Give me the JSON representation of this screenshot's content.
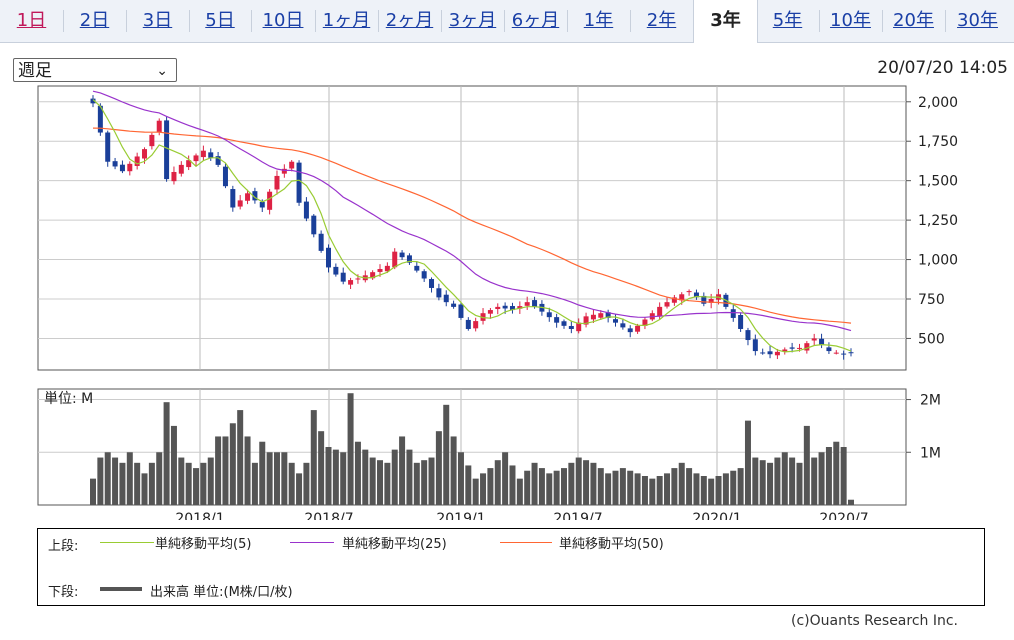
{
  "tabs": [
    {
      "label": "1日",
      "selected": false
    },
    {
      "label": "2日",
      "selected": false
    },
    {
      "label": "3日",
      "selected": false
    },
    {
      "label": "5日",
      "selected": false
    },
    {
      "label": "10日",
      "selected": false
    },
    {
      "label": "1ヶ月",
      "selected": false
    },
    {
      "label": "2ヶ月",
      "selected": false
    },
    {
      "label": "3ヶ月",
      "selected": false
    },
    {
      "label": "6ヶ月",
      "selected": false
    },
    {
      "label": "1年",
      "selected": false
    },
    {
      "label": "2年",
      "selected": false
    },
    {
      "label": "3年",
      "selected": true
    },
    {
      "label": "5年",
      "selected": false
    },
    {
      "label": "10年",
      "selected": false
    },
    {
      "label": "20年",
      "selected": false
    },
    {
      "label": "30年",
      "selected": false
    }
  ],
  "period_select": {
    "value": "週足",
    "icon": "chevron-down-icon"
  },
  "timestamp": "20/07/20 14:05",
  "legend": {
    "upper_label": "上段:",
    "lower_label": "下段:",
    "items": [
      {
        "label": "単純移動平均(5)",
        "color": "#99cc33"
      },
      {
        "label": "単純移動平均(25)",
        "color": "#9933cc"
      },
      {
        "label": "単純移動平均(50)",
        "color": "#ff6633"
      }
    ],
    "volume": {
      "label": "出来高 単位:(M株/口/枚)",
      "color": "#555555"
    }
  },
  "credit": "(c)Ouants Research Inc.",
  "chart_data": {
    "type": "candlestick",
    "price_axis": {
      "ticks": [
        "2,000",
        "1,750",
        "1,500",
        "1,250",
        "1,000",
        "750",
        "500"
      ],
      "values": [
        2000,
        1750,
        1500,
        1250,
        1000,
        750,
        500
      ],
      "ylim": [
        300,
        2100
      ]
    },
    "volume_axis": {
      "unit_label": "単位: M",
      "ticks": [
        "2M",
        "1M"
      ],
      "values": [
        2,
        1
      ],
      "ylim": [
        0,
        2.2
      ]
    },
    "x_labels": [
      "2018/1",
      "2018/7",
      "2019/1",
      "2019/7",
      "2020/1",
      "2020/7"
    ],
    "colors": {
      "up": "#dd2244",
      "down": "#1a3f99",
      "volume": "#555555",
      "ma5": "#99cc33",
      "ma25": "#9933cc",
      "ma50": "#ff6633"
    },
    "grid": true,
    "close_anchors": [
      [
        0,
        1990
      ],
      [
        2,
        1620
      ],
      [
        4,
        1560
      ],
      [
        7,
        1700
      ],
      [
        9,
        1880
      ],
      [
        10,
        1510
      ],
      [
        12,
        1600
      ],
      [
        15,
        1690
      ],
      [
        17,
        1600
      ],
      [
        19,
        1330
      ],
      [
        21,
        1420
      ],
      [
        23,
        1330
      ],
      [
        25,
        1530
      ],
      [
        27,
        1620
      ],
      [
        28,
        1360
      ],
      [
        30,
        1160
      ],
      [
        32,
        950
      ],
      [
        34,
        860
      ],
      [
        36,
        880
      ],
      [
        38,
        920
      ],
      [
        40,
        960
      ],
      [
        41,
        1050
      ],
      [
        43,
        980
      ],
      [
        45,
        880
      ],
      [
        47,
        760
      ],
      [
        49,
        700
      ],
      [
        51,
        560
      ],
      [
        53,
        660
      ],
      [
        55,
        700
      ],
      [
        57,
        680
      ],
      [
        59,
        730
      ],
      [
        61,
        670
      ],
      [
        63,
        600
      ],
      [
        65,
        560
      ],
      [
        67,
        640
      ],
      [
        69,
        660
      ],
      [
        71,
        600
      ],
      [
        73,
        540
      ],
      [
        75,
        620
      ],
      [
        77,
        700
      ],
      [
        79,
        760
      ],
      [
        81,
        800
      ],
      [
        83,
        720
      ],
      [
        85,
        780
      ],
      [
        86,
        700
      ],
      [
        88,
        560
      ],
      [
        90,
        420
      ],
      [
        92,
        400
      ],
      [
        94,
        430
      ],
      [
        96,
        440
      ],
      [
        98,
        500
      ],
      [
        100,
        420
      ],
      [
        102,
        400
      ],
      [
        103,
        410
      ]
    ],
    "volume_anchors": [
      [
        0,
        0.5
      ],
      [
        1,
        0.9
      ],
      [
        2,
        1.0
      ],
      [
        4,
        0.8
      ],
      [
        5,
        1.0
      ],
      [
        7,
        0.6
      ],
      [
        9,
        1.0
      ],
      [
        10,
        1.95
      ],
      [
        11,
        1.5
      ],
      [
        12,
        0.9
      ],
      [
        14,
        0.7
      ],
      [
        16,
        0.9
      ],
      [
        17,
        1.3
      ],
      [
        18,
        1.3
      ],
      [
        20,
        1.8
      ],
      [
        22,
        0.8
      ],
      [
        23,
        1.2
      ],
      [
        24,
        1.0
      ],
      [
        26,
        1.0
      ],
      [
        28,
        0.6
      ],
      [
        29,
        0.8
      ],
      [
        30,
        1.8
      ],
      [
        31,
        1.4
      ],
      [
        32,
        1.1
      ],
      [
        34,
        1.0
      ],
      [
        35,
        2.12
      ],
      [
        36,
        1.2
      ],
      [
        38,
        0.9
      ],
      [
        40,
        0.8
      ],
      [
        42,
        1.3
      ],
      [
        44,
        0.8
      ],
      [
        46,
        0.9
      ],
      [
        48,
        1.9
      ],
      [
        49,
        1.3
      ],
      [
        50,
        1.0
      ],
      [
        52,
        0.5
      ],
      [
        54,
        0.7
      ],
      [
        56,
        1.0
      ],
      [
        58,
        0.5
      ],
      [
        60,
        0.8
      ],
      [
        62,
        0.6
      ],
      [
        64,
        0.7
      ],
      [
        66,
        0.9
      ],
      [
        68,
        0.8
      ],
      [
        70,
        0.6
      ],
      [
        72,
        0.7
      ],
      [
        74,
        0.6
      ],
      [
        76,
        0.5
      ],
      [
        78,
        0.6
      ],
      [
        80,
        0.8
      ],
      [
        82,
        0.6
      ],
      [
        84,
        0.5
      ],
      [
        86,
        0.6
      ],
      [
        88,
        0.7
      ],
      [
        89,
        1.6
      ],
      [
        90,
        0.9
      ],
      [
        92,
        0.8
      ],
      [
        94,
        1.0
      ],
      [
        96,
        0.8
      ],
      [
        97,
        1.5
      ],
      [
        98,
        0.9
      ],
      [
        100,
        1.1
      ],
      [
        101,
        1.2
      ],
      [
        102,
        1.1
      ],
      [
        103,
        0.1
      ]
    ],
    "ma_from": {
      "ma5": 0,
      "ma25": 0,
      "ma50": 0
    },
    "ma_start_offsets": {
      "ma5": [
        1950,
        2030,
        2060
      ],
      "ma25": 2060,
      "ma50": 1830
    }
  }
}
